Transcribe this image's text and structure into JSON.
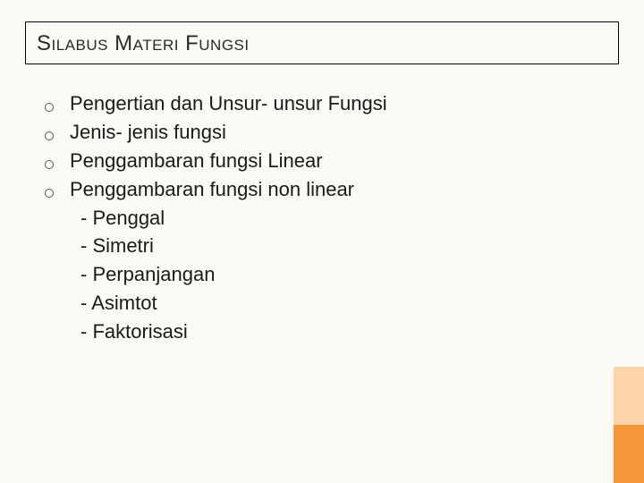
{
  "title": "Silabus Materi Fungsi",
  "items": [
    {
      "label": "Pengertian dan Unsur- unsur Fungsi",
      "subitems": []
    },
    {
      "label": "Jenis- jenis fungsi",
      "subitems": []
    },
    {
      "label": "Penggambaran fungsi Linear",
      "subitems": []
    },
    {
      "label": "Penggambaran fungsi non linear",
      "subitems": [
        "- Penggal",
        "- Simetri",
        "- Perpanjangan",
        "- Asimtot",
        "- Faktorisasi"
      ]
    }
  ],
  "colors": {
    "accent_light": "#fbd4a9",
    "accent_dark": "#f4963b"
  }
}
